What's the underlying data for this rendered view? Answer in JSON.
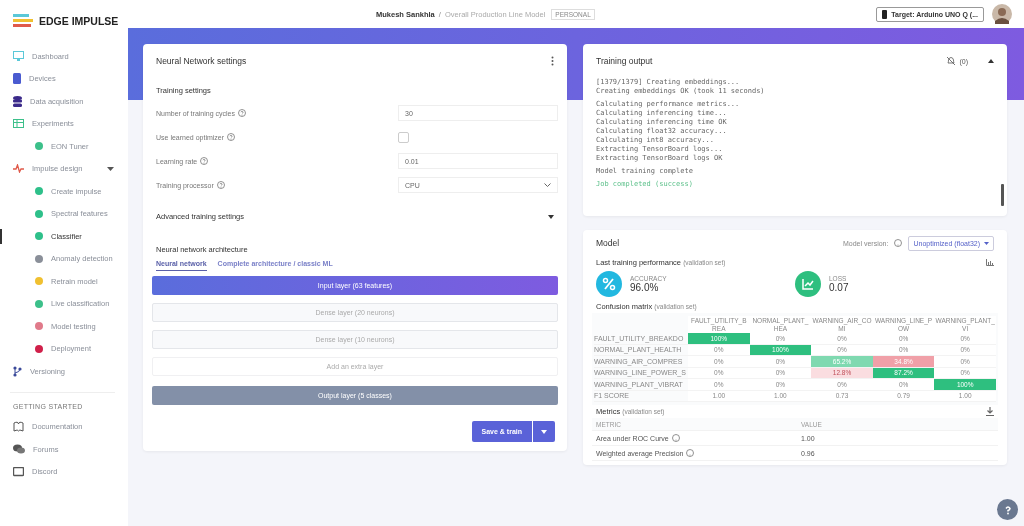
{
  "brand": "EDGE IMPULSE",
  "header": {
    "user": "Mukesh Sankhla",
    "separator": "/",
    "project": "Overall Production Line Model",
    "badge": "PERSONAL",
    "target": "Target: Arduino UNO Q (..."
  },
  "sidebar": {
    "items": [
      {
        "label": "Dashboard",
        "sub": false,
        "selected": false,
        "color": "#5bc8d8"
      },
      {
        "label": "Devices",
        "sub": false,
        "selected": false,
        "color": "#4a5bd0"
      },
      {
        "label": "Data acquisition",
        "sub": false,
        "selected": false,
        "color": "#3b2a8a"
      },
      {
        "label": "Experiments",
        "sub": false,
        "selected": false,
        "color": "#3cc08a"
      },
      {
        "label": "EON Tuner",
        "sub": true,
        "selected": false,
        "color": "#3cc08a"
      },
      {
        "label": "Impulse design",
        "sub": false,
        "selected": false,
        "color": "#e05a4a",
        "expanded": true
      },
      {
        "label": "Create impulse",
        "sub": true,
        "selected": false,
        "color": "#2ec08a"
      },
      {
        "label": "Spectral features",
        "sub": true,
        "selected": false,
        "color": "#2ec08a"
      },
      {
        "label": "Classifier",
        "sub": true,
        "selected": true,
        "color": "#2ec08a"
      },
      {
        "label": "Anomaly detection",
        "sub": true,
        "selected": false,
        "color": "#8a8f99"
      },
      {
        "label": "Retrain model",
        "sub": true,
        "selected": false,
        "color": "#f0c030"
      },
      {
        "label": "Live classification",
        "sub": true,
        "selected": false,
        "color": "#3cc08a"
      },
      {
        "label": "Model testing",
        "sub": true,
        "selected": false,
        "color": "#e07a8a"
      },
      {
        "label": "Deployment",
        "sub": true,
        "selected": false,
        "color": "#d0204a"
      },
      {
        "label": "Versioning",
        "sub": false,
        "selected": false,
        "color": "#3b4a9a"
      }
    ],
    "section": "GETTING STARTED",
    "links": [
      {
        "label": "Documentation"
      },
      {
        "label": "Forums"
      },
      {
        "label": "Discord"
      }
    ]
  },
  "nn_settings": {
    "title": "Neural Network settings",
    "training_title": "Training settings",
    "fields": [
      {
        "kind": "input",
        "label": "Number of training cycles",
        "value": "30"
      },
      {
        "kind": "checkbox",
        "label": "Use learned optimizer",
        "checked": false
      },
      {
        "kind": "input",
        "label": "Learning rate",
        "value": "0.01"
      },
      {
        "kind": "select",
        "label": "Training processor",
        "value": "CPU"
      }
    ],
    "advanced": {
      "label": "Advanced training settings",
      "expanded": false
    },
    "arch_title": "Neural network architecture",
    "tabs": [
      {
        "label": "Neural network",
        "selected": true
      },
      {
        "label": "Complete architecture / classic ML",
        "selected": false
      }
    ],
    "layers": [
      {
        "kind": "input",
        "label": "Input layer (63 features)"
      },
      {
        "kind": "dense",
        "label": "Dense layer (20 neurons)"
      },
      {
        "kind": "dense",
        "label": "Dense layer (10 neurons)"
      },
      {
        "kind": "add",
        "label": "Add an extra layer"
      },
      {
        "kind": "output",
        "label": "Output layer (5 classes)"
      }
    ],
    "save_button": "Save & train"
  },
  "training_output": {
    "title": "Training output",
    "notifications": "(0)",
    "expanded": true,
    "lines": [
      {
        "text": "[1379/1379] Creating embeddings...",
        "kind": "log"
      },
      {
        "text": "Creating embeddings OK (took 11 seconds)",
        "kind": "log"
      },
      {
        "kind": "blank"
      },
      {
        "text": "Calculating performance metrics...",
        "kind": "log"
      },
      {
        "text": "Calculating inferencing time...",
        "kind": "log"
      },
      {
        "text": "Calculating inferencing time OK",
        "kind": "log"
      },
      {
        "text": "Calculating float32 accuracy...",
        "kind": "log"
      },
      {
        "text": "Calculating int8 accuracy...",
        "kind": "log"
      },
      {
        "text": "Extracting TensorBoard logs...",
        "kind": "log"
      },
      {
        "text": "Extracting TensorBoard logs OK",
        "kind": "log"
      },
      {
        "kind": "blank"
      },
      {
        "text": "Model training complete",
        "kind": "log"
      },
      {
        "kind": "blank"
      },
      {
        "text": "Job completed (success)",
        "kind": "success"
      }
    ]
  },
  "model": {
    "title": "Model",
    "version_label": "Model version:",
    "version": "Unoptimized (float32)",
    "performance_title": "Last training performance",
    "performance_note": "(validation set)",
    "accuracy": {
      "label": "ACCURACY",
      "value": "96.0%"
    },
    "loss": {
      "label": "LOSS",
      "value": "0.07"
    },
    "matrix_title": "Confusion matrix",
    "matrix_note": "(validation set)",
    "columns": [
      "FAULT_UTILITY_BREA",
      "NORMAL_PLANT_HEA",
      "WARNING_AIR_COMI",
      "WARNING_LINE_POW",
      "WARNING_PLANT_VI"
    ],
    "rows": [
      {
        "label": "FAULT_UTILITY_BREAKDO",
        "cells": [
          {
            "text": "100%",
            "color": "#2ebf7f"
          },
          {
            "text": "0%"
          },
          {
            "text": "0%"
          },
          {
            "text": "0%"
          },
          {
            "text": "0%"
          }
        ]
      },
      {
        "label": "NORMAL_PLANT_HEALTH",
        "cells": [
          {
            "text": "0%"
          },
          {
            "text": "100%",
            "color": "#2ebf7f"
          },
          {
            "text": "0%"
          },
          {
            "text": "0%"
          },
          {
            "text": "0%"
          }
        ]
      },
      {
        "label": "WARNING_AIR_COMPRES",
        "cells": [
          {
            "text": "0%"
          },
          {
            "text": "0%"
          },
          {
            "text": "65.2%",
            "color": "#7fd9b0"
          },
          {
            "text": "34.8%",
            "color": "#f0a0a8"
          },
          {
            "text": "0%"
          }
        ]
      },
      {
        "label": "WARNING_LINE_POWER_S",
        "cells": [
          {
            "text": "0%"
          },
          {
            "text": "0%"
          },
          {
            "text": "12.8%",
            "color": "#fadde0"
          },
          {
            "text": "87.2%",
            "color": "#2ebf7f"
          },
          {
            "text": "0%"
          }
        ]
      },
      {
        "label": "WARNING_PLANT_VIBRAT",
        "cells": [
          {
            "text": "0%"
          },
          {
            "text": "0%"
          },
          {
            "text": "0%"
          },
          {
            "text": "0%"
          },
          {
            "text": "100%",
            "color": "#2ebf7f"
          }
        ]
      },
      {
        "label": "F1 SCORE",
        "cells": [
          {
            "text": "1.00"
          },
          {
            "text": "1.00"
          },
          {
            "text": "0.73"
          },
          {
            "text": "0.79"
          },
          {
            "text": "1.00"
          }
        ]
      }
    ],
    "metrics_title": "Metrics",
    "metrics_note": "(validation set)",
    "metrics_columns": [
      "METRIC",
      "VALUE"
    ],
    "metrics": [
      {
        "name": "Area under ROC Curve",
        "value": "1.00"
      },
      {
        "name": "Weighted average Precision",
        "value": "0.96"
      }
    ]
  }
}
